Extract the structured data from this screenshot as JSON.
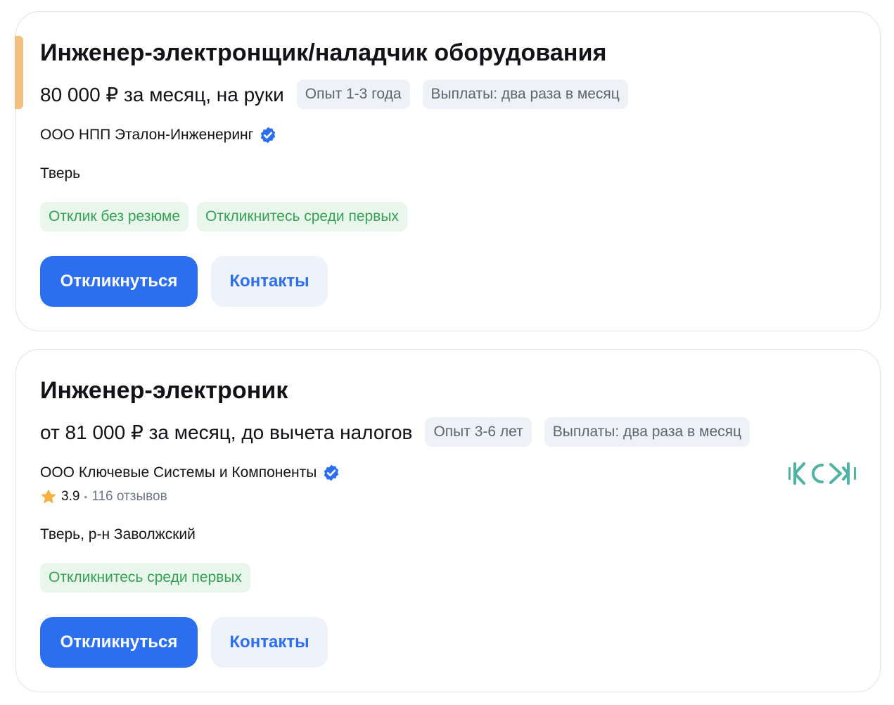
{
  "vacancies": [
    {
      "title": "Инженер-электронщик/наладчик оборудования",
      "salary": "80 000 ₽ за месяц, на руки",
      "experience": "Опыт 1-3 года",
      "payouts": "Выплаты: два раза в месяц",
      "company": "ООО НПП Эталон-Инженеринг",
      "city": "Тверь",
      "tags": [
        "Отклик без резюме",
        "Откликнитесь среди первых"
      ],
      "apply_label": "Откликнуться",
      "contacts_label": "Контакты",
      "accent_color": "#f2c07e"
    },
    {
      "title": "Инженер-электроник",
      "salary": "от 81 000 ₽ за месяц, до вычета налогов",
      "experience": "Опыт 3-6 лет",
      "payouts": "Выплаты: два раза в месяц",
      "company": "ООО Ключевые Системы и Компоненты",
      "rating": "3.9",
      "reviews": "116 отзывов",
      "city": "Тверь, р-н Заволжский",
      "tags": [
        "Откликнитесь среди первых"
      ],
      "apply_label": "Откликнуться",
      "contacts_label": "Контакты",
      "logo_color": "#4fb3a4"
    }
  ],
  "colors": {
    "primary": "#2b6ff0",
    "verified": "#2b6ff0",
    "tag_green_text": "#35a154",
    "tag_green_bg": "#e9f6ec",
    "chip_gray_bg": "#eef1f5",
    "star": "#f5b041"
  },
  "icons": {
    "verified": "verified-badge-icon",
    "star": "star-icon",
    "logo": "ksk-logo"
  }
}
